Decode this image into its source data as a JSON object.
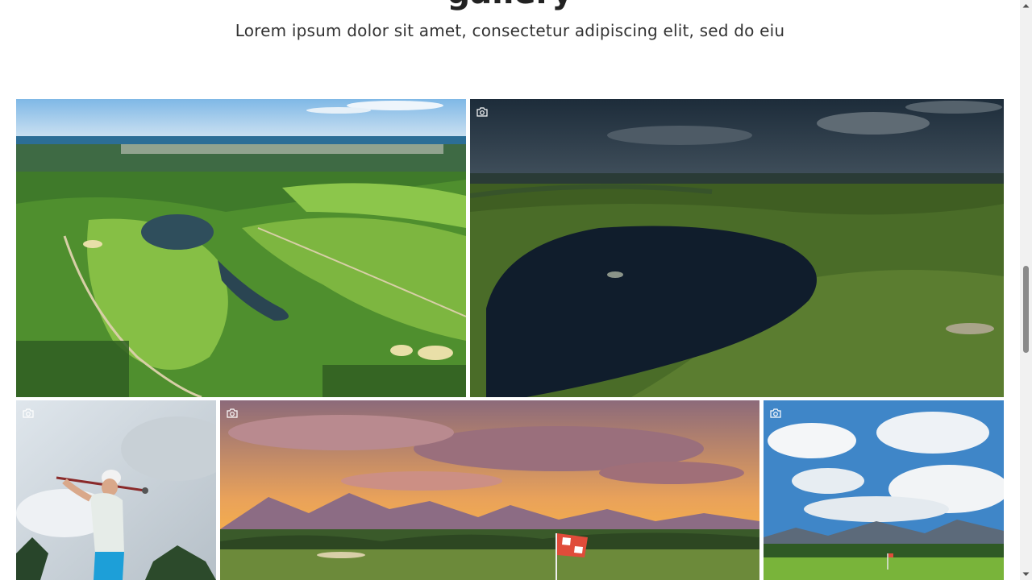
{
  "section": {
    "heading": "gallery",
    "subtitle": "Lorem ipsum dolor sit amet, consectetur adipiscing elit, sed do eiu"
  },
  "gallery": {
    "items": [
      {
        "subject": "aerial view of seaside golf course",
        "camera_icon": false
      },
      {
        "subject": "golf course lake at dusk",
        "camera_icon": true
      },
      {
        "subject": "golfer mid-swing against cloudy sky",
        "camera_icon": true
      },
      {
        "subject": "sunset over mountains with checkered flag",
        "camera_icon": true
      },
      {
        "subject": "golf course under blue sky with mountains",
        "camera_icon": true
      }
    ]
  },
  "colors": {
    "heading": "#222222",
    "subtitle": "#333333",
    "grass": "#6fa83a",
    "sky": "#3f86c8"
  }
}
